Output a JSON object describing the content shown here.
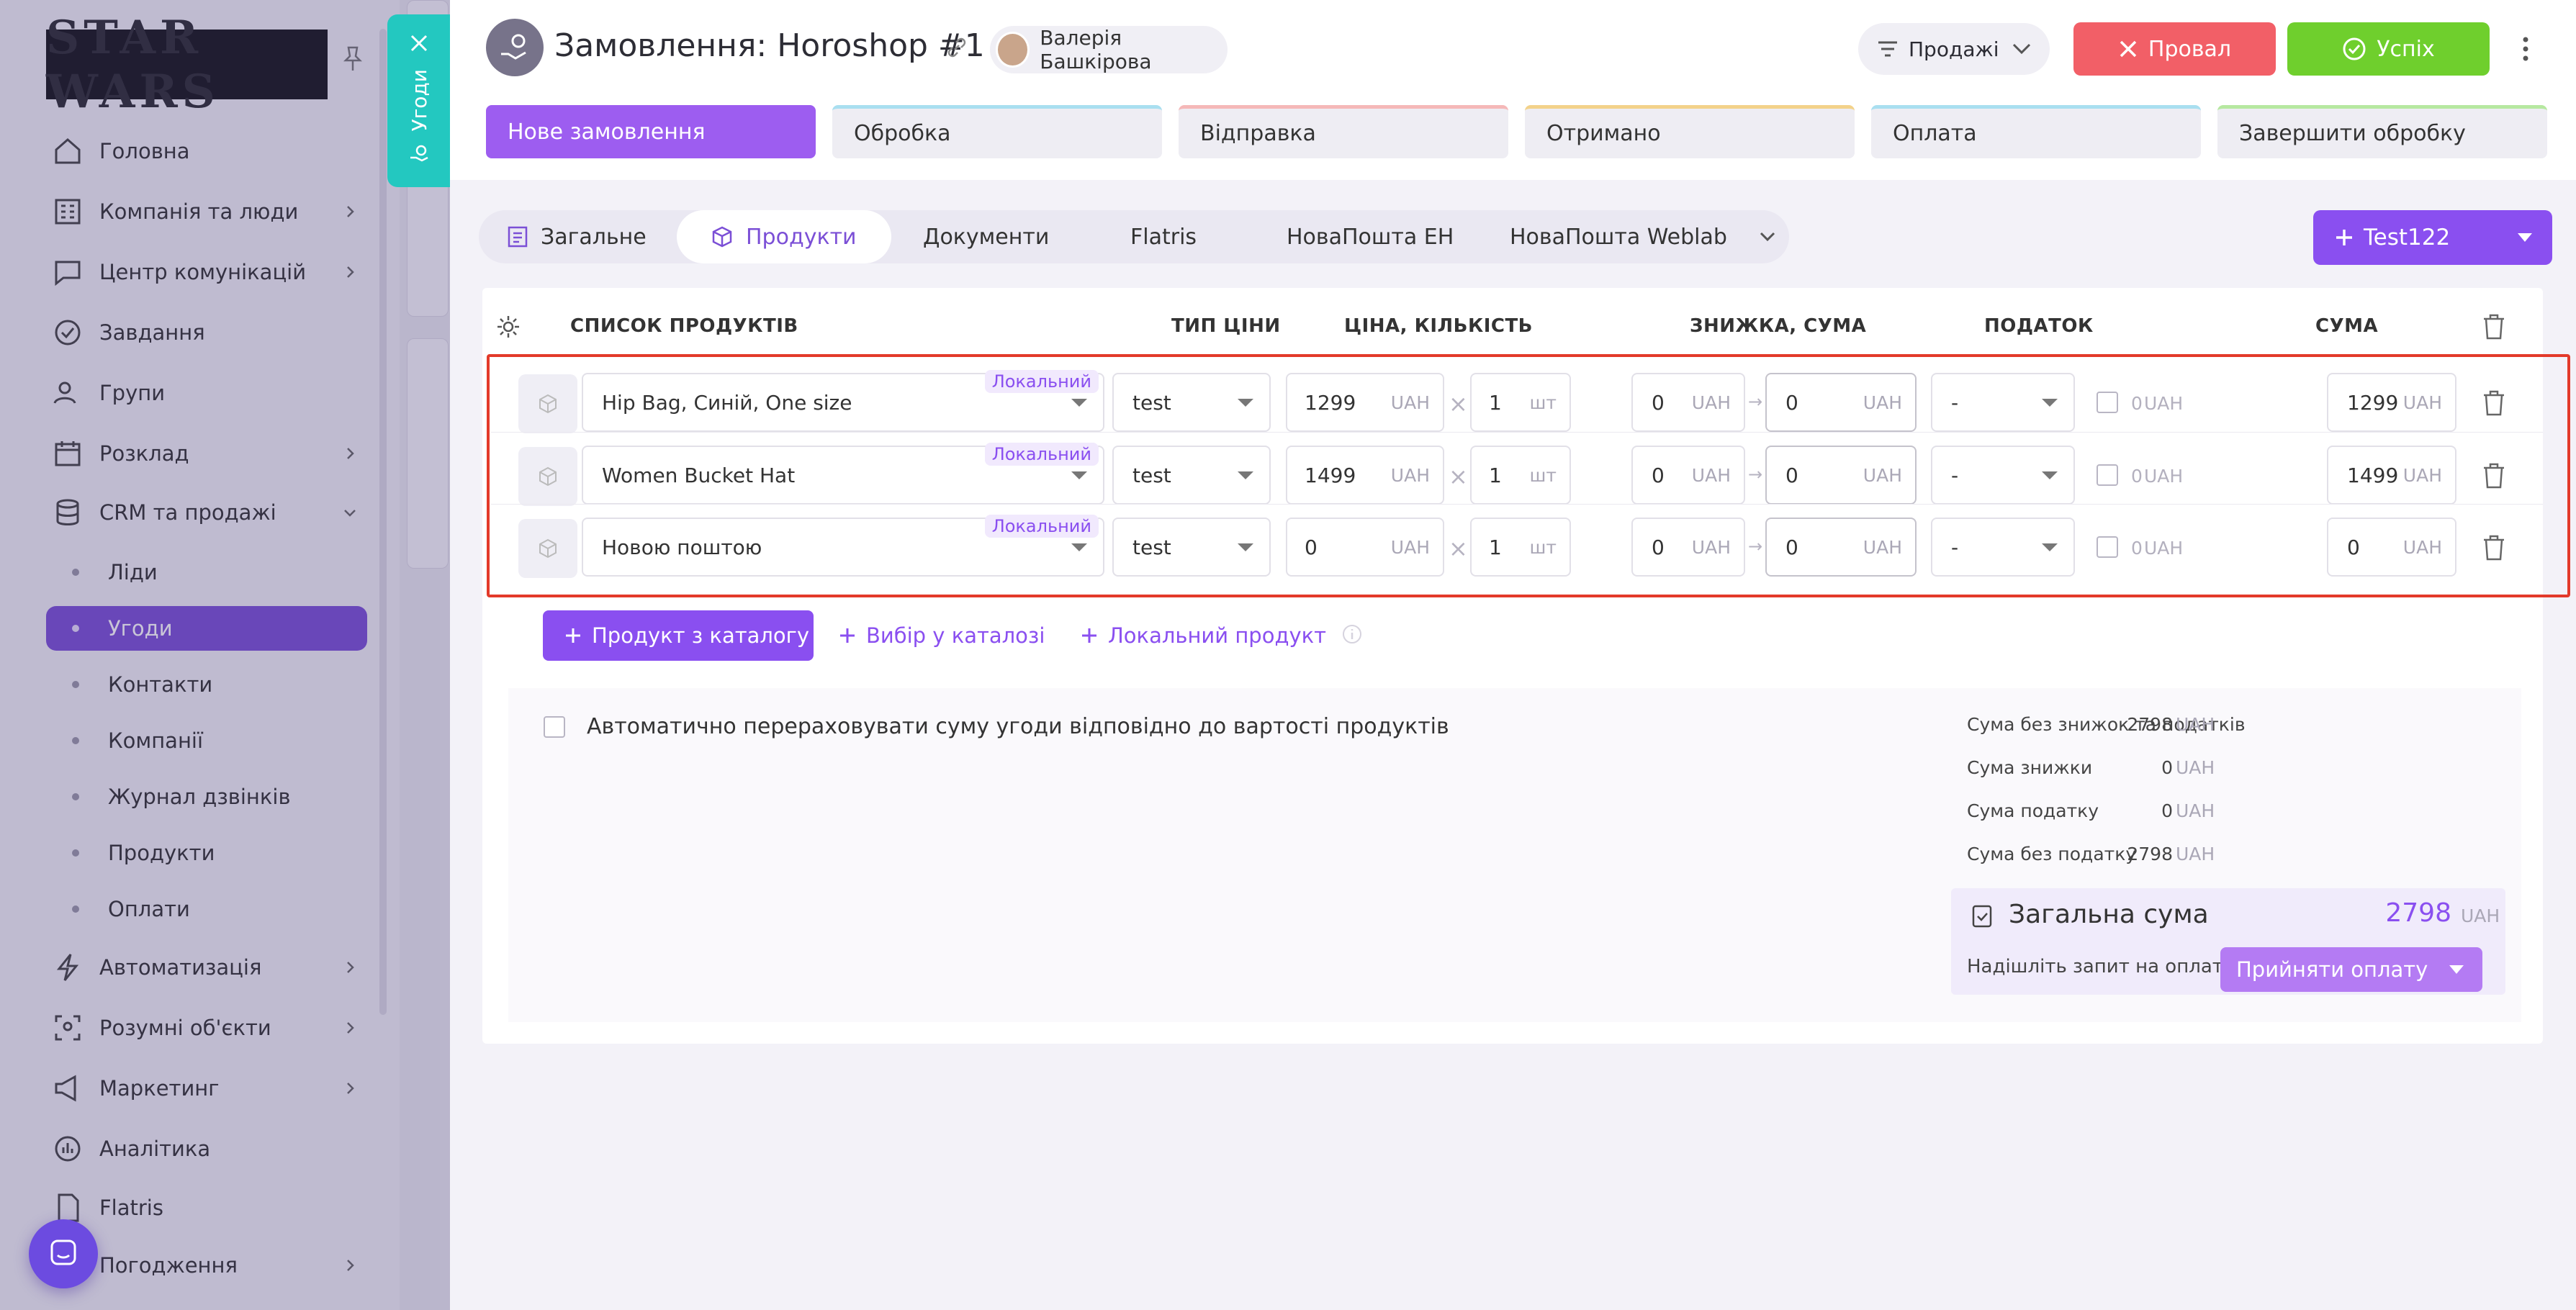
{
  "sidebar": {
    "logo_text": "STAR WARS",
    "items": [
      {
        "label": "Головна",
        "icon": "home-icon"
      },
      {
        "label": "Компанія та люди",
        "icon": "building-icon"
      },
      {
        "label": "Центр комунікацій",
        "icon": "chat-icon"
      },
      {
        "label": "Завдання",
        "icon": "check-circle-icon"
      },
      {
        "label": "Групи",
        "icon": "group-icon"
      },
      {
        "label": "Розклад",
        "icon": "calendar-icon"
      },
      {
        "label": "CRM та продажі",
        "icon": "database-icon"
      },
      {
        "label": "Автоматизація",
        "icon": "bolt-icon"
      },
      {
        "label": "Розумні об'єкти",
        "icon": "scan-icon"
      },
      {
        "label": "Маркетинг",
        "icon": "megaphone-icon"
      },
      {
        "label": "Аналітика",
        "icon": "chart-icon"
      },
      {
        "label": "Flatris",
        "icon": "document-icon"
      },
      {
        "label": "Погодження",
        "icon": "approval-icon"
      }
    ],
    "crm_sub": [
      "Ліди",
      "Угоди",
      "Контакти",
      "Компанії",
      "Журнал дзвінків",
      "Продукти",
      "Оплати"
    ],
    "active_sub": "Угоди"
  },
  "deals_tab": {
    "label": "Угоди"
  },
  "header": {
    "title": "Замовлення: Horoshop #1",
    "user": "Валерія Башкірова",
    "pipeline": "Продажі",
    "fail_label": "Провал",
    "success_label": "Успіх"
  },
  "stages": [
    {
      "label": "Нове замовлення",
      "active": true,
      "color": "#9d5df0"
    },
    {
      "label": "Обробка",
      "color": "#a9dff0"
    },
    {
      "label": "Відправка",
      "color": "#f5b8b8"
    },
    {
      "label": "Отримано",
      "color": "#f3d28a"
    },
    {
      "label": "Оплата",
      "color": "#a9dff0"
    },
    {
      "label": "Завершити обробку",
      "color": "#b6e8a0"
    }
  ],
  "tabs": [
    "Загальне",
    "Продукти",
    "Документи",
    "Flatris",
    "НоваПошта ЕН",
    "НоваПошта Weblab"
  ],
  "active_tab": "Продукти",
  "action_button": "Test122",
  "table": {
    "headers": {
      "products": "СПИСОК ПРОДУКТІВ",
      "price_type": "ТИП ЦІНИ",
      "price_qty": "ЦІНА, КІЛЬКІСТЬ",
      "discount": "ЗНИЖКА, СУМА",
      "tax": "ПОДАТОК",
      "sum": "СУМА"
    },
    "rows": [
      {
        "name": "Hip Bag, Синій, One size",
        "badge": "Локальний",
        "price_type": "test",
        "price": "1299",
        "currency": "UAH",
        "qty": "1",
        "unit": "шт",
        "discount": "0",
        "discount_sum": "0",
        "tax": "-",
        "tax_amount": "0",
        "sum": "1299"
      },
      {
        "name": "Women Bucket Hat",
        "badge": "Локальний",
        "price_type": "test",
        "price": "1499",
        "currency": "UAH",
        "qty": "1",
        "unit": "шт",
        "discount": "0",
        "discount_sum": "0",
        "tax": "-",
        "tax_amount": "0",
        "sum": "1499"
      },
      {
        "name": "Новою поштою",
        "badge": "Локальний",
        "price_type": "test",
        "price": "0",
        "currency": "UAH",
        "qty": "1",
        "unit": "шт",
        "discount": "0",
        "discount_sum": "0",
        "tax": "-",
        "tax_amount": "0",
        "sum": "0"
      }
    ]
  },
  "add_buttons": {
    "catalog": "Продукт з каталогу",
    "pick": "Вибір у каталозі",
    "local": "Локальний продукт"
  },
  "auto_recalc_label": "Автоматично перераховувати суму угоди відповідно до вартості продуктів",
  "summary": {
    "currency": "UAH",
    "lines": [
      {
        "label": "Сума без знижок та податків",
        "value": "2798"
      },
      {
        "label": "Сума знижки",
        "value": "0"
      },
      {
        "label": "Сума податку",
        "value": "0"
      },
      {
        "label": "Сума без податку",
        "value": "2798"
      }
    ],
    "total_label": "Загальна сума",
    "total_value": "2798",
    "payment_request": "Надішліть запит на оплату",
    "accept_payment": "Прийняти оплату"
  },
  "colors": {
    "accent": "#8a4ff0",
    "fail": "#f25f67",
    "success": "#6fcf2d",
    "highlight": "#e33a2a"
  }
}
